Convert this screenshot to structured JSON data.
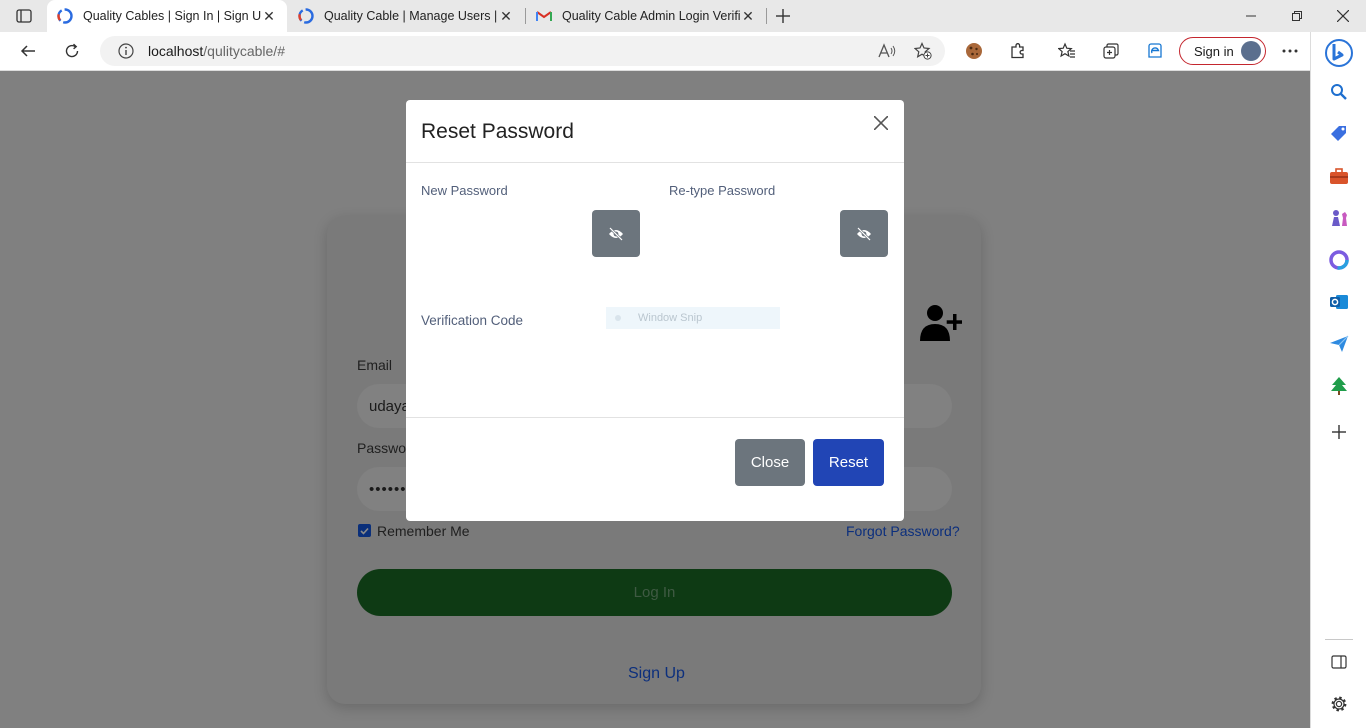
{
  "browser": {
    "tabs": [
      {
        "title": "Quality Cables | Sign In | Sign Up",
        "active": true,
        "favicon": "quality-cable-favicon-icon"
      },
      {
        "title": "Quality Cable | Manage Users | A",
        "active": false,
        "favicon": "quality-cable-favicon-icon"
      },
      {
        "title": "Quality Cable Admin Login Verifi",
        "active": false,
        "favicon": "gmail-icon"
      }
    ],
    "url_host": "localhost",
    "url_path": "/qulitycable/#",
    "signin_label": "Sign in"
  },
  "page": {
    "email_label": "Email",
    "email_value": "udaya",
    "password_label": "Passwor",
    "password_value": "••••••••",
    "remember_label": "Remember Me",
    "remember_checked": true,
    "forgot_label": "Forgot Password?",
    "login_label": "Log In",
    "signup_label": "Sign Up"
  },
  "modal": {
    "title": "Reset Password",
    "new_password_label": "New Password",
    "retype_password_label": "Re-type Password",
    "verification_label": "Verification Code",
    "snip_text": "Window Snip",
    "close_label": "Close",
    "reset_label": "Reset"
  },
  "colors": {
    "overlay": "#808080",
    "primary": "#2145b5",
    "secondary": "#6c757d",
    "login_green": "#0e3a14",
    "link_blue": "#0c2f7d"
  }
}
